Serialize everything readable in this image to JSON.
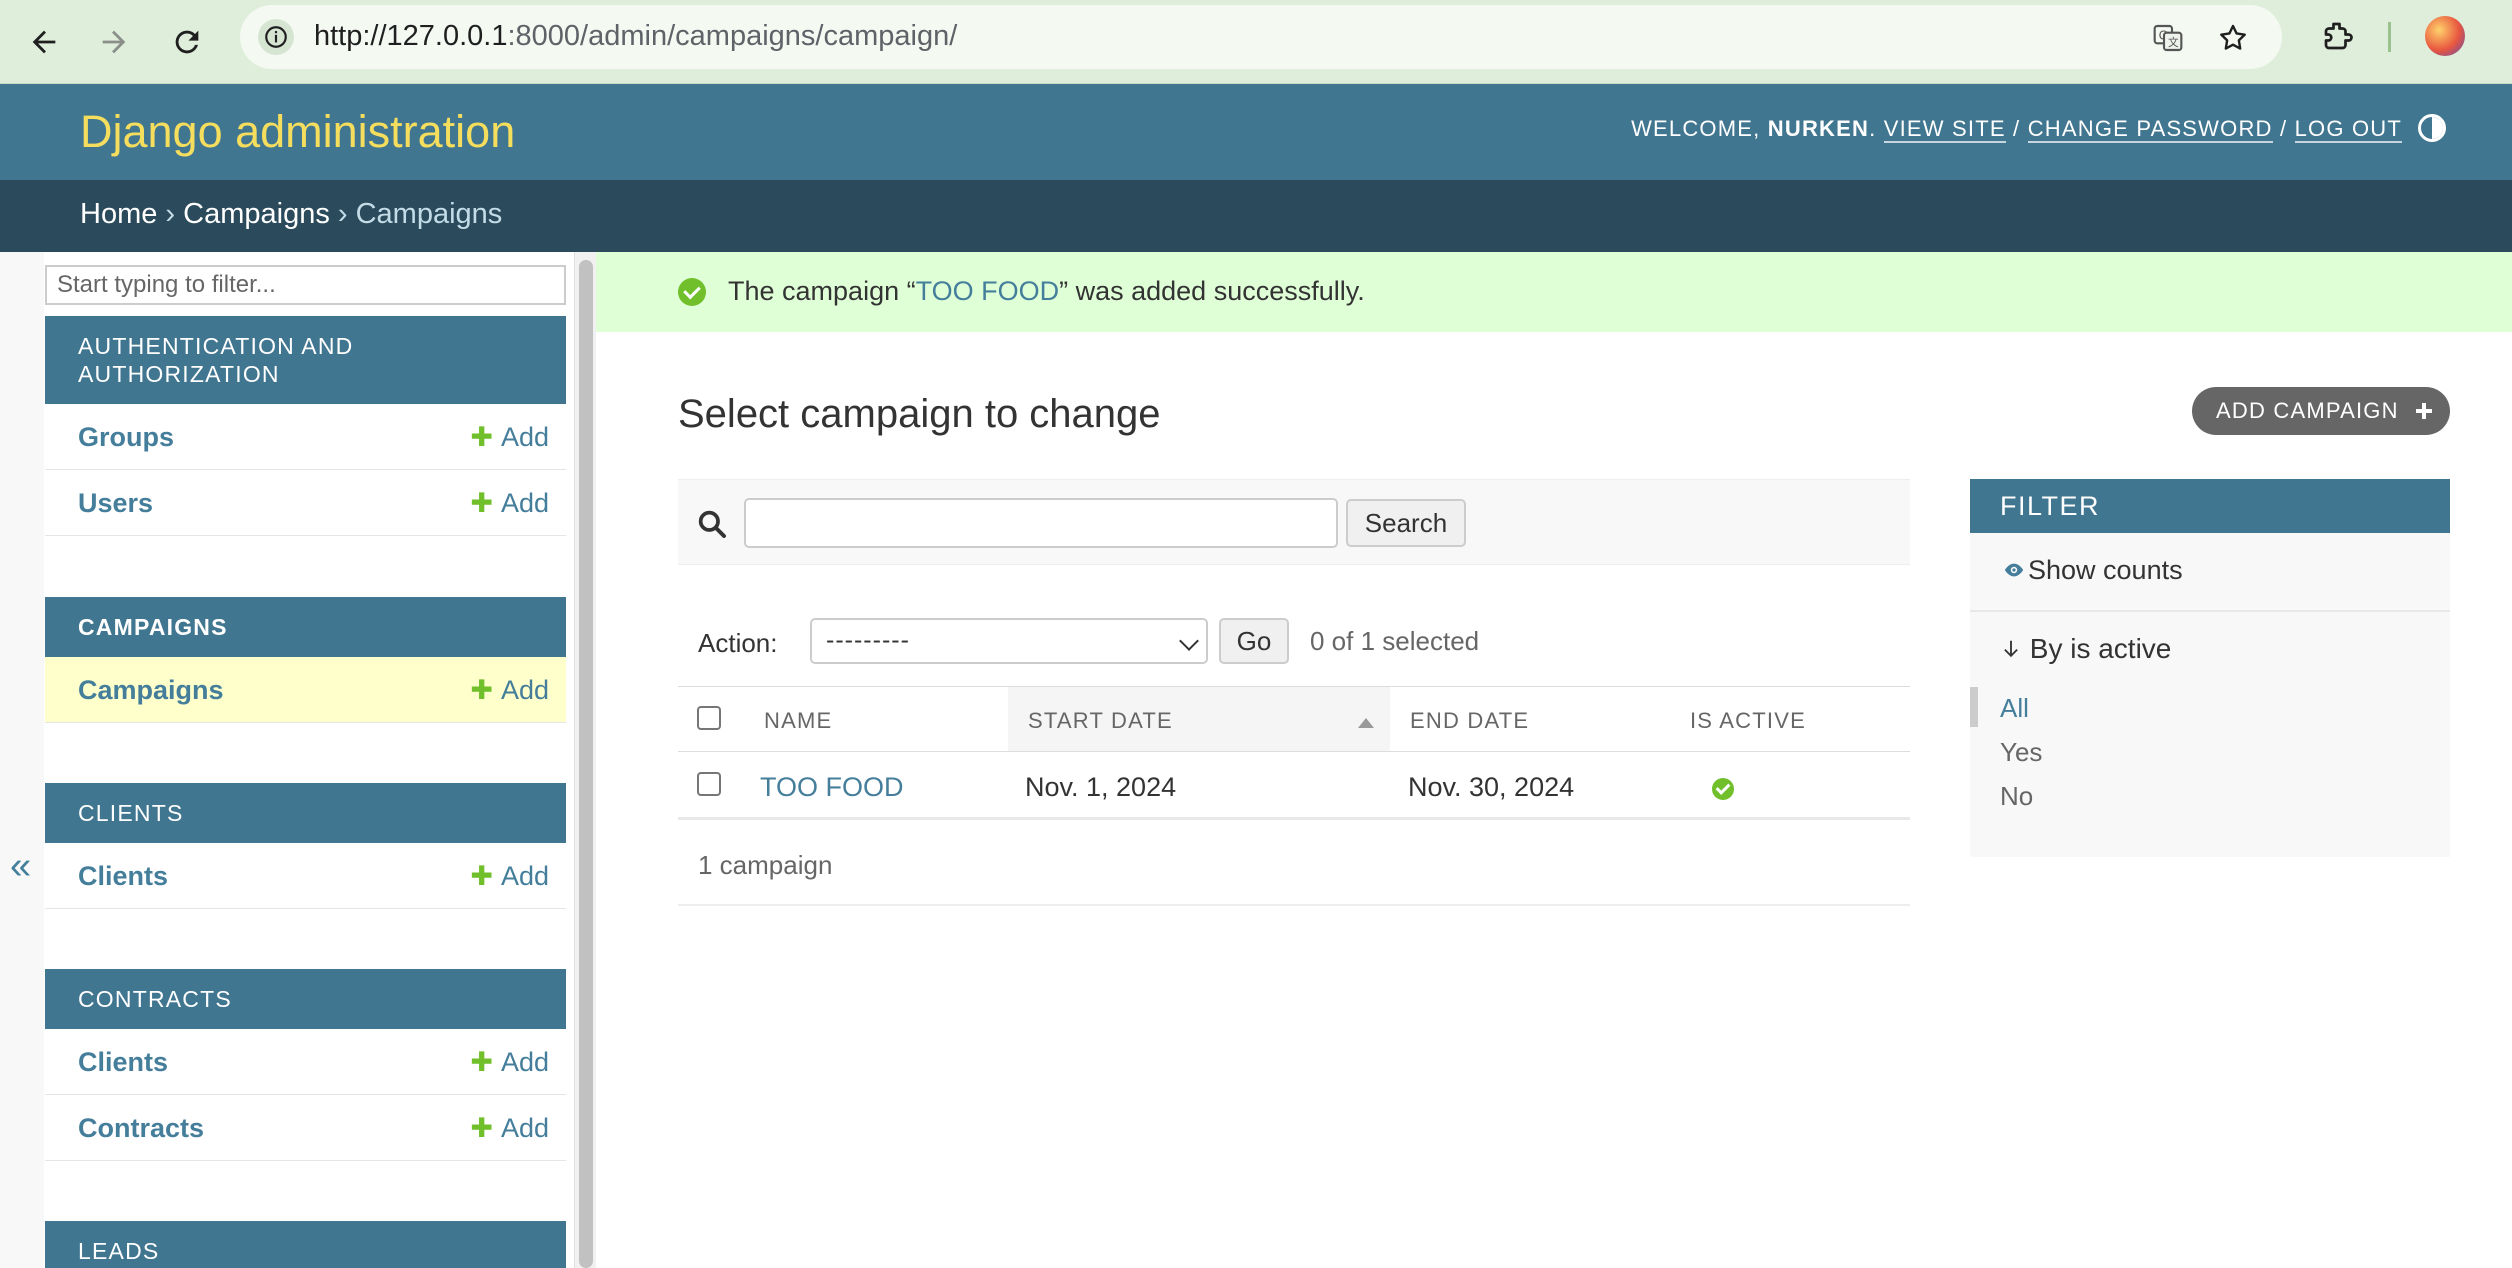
{
  "browser": {
    "url_host": "http://127.0.0.1",
    "url_rest": ":8000/admin/campaigns/campaign/"
  },
  "header": {
    "branding": "Django administration",
    "welcome": "Welcome,",
    "username": "Nurken",
    "view_site": "View site",
    "change_password": "Change password",
    "log_out": "Log out"
  },
  "breadcrumbs": {
    "home": "Home",
    "sep1": " › ",
    "app": "Campaigns",
    "sep2": " › ",
    "current": "Campaigns"
  },
  "sidebar": {
    "filter_placeholder": "Start typing to filter...",
    "collapse_glyph": "«",
    "add_label": "Add",
    "modules": {
      "auth": {
        "caption_line1": "Authentication and",
        "caption_line2": "authorization",
        "models": [
          "Groups",
          "Users"
        ]
      },
      "campaigns": {
        "caption": "Campaigns",
        "models": [
          "Campaigns"
        ]
      },
      "clients": {
        "caption": "Clients",
        "models": [
          "Clients"
        ]
      },
      "contracts": {
        "caption": "Contracts",
        "models": [
          "Clients",
          "Contracts"
        ]
      },
      "leads": {
        "caption": "Leads"
      }
    }
  },
  "messages": {
    "success_before": "The campaign “",
    "success_object": "TOO FOOD",
    "success_after": "” was added successfully."
  },
  "content": {
    "title": "Select campaign to change",
    "add_button": "Add campaign",
    "search_button": "Search",
    "search_value": "",
    "action_label": "Action:",
    "action_selected": "---------",
    "go_button": "Go",
    "selected_count": "0 of 1 selected",
    "columns": [
      "Name",
      "Start date",
      "End date",
      "Is active"
    ],
    "rows": [
      {
        "name": "TOO FOOD",
        "start_date": "Nov. 1, 2024",
        "end_date": "Nov. 30, 2024",
        "is_active": true
      }
    ],
    "paginator": "1 campaign"
  },
  "filter": {
    "title": "Filter",
    "show_counts": "Show counts",
    "heading": "By is active",
    "options": [
      "All",
      "Yes",
      "No"
    ],
    "selected": "All"
  },
  "colors": {
    "header_bg": "#417690",
    "breadcrumbs_bg": "#2b4b5c",
    "branding": "#f5dd5d",
    "link": "#447e9b",
    "add_green": "#70bf2b",
    "success_bg": "#dfffd7",
    "current_model_bg": "#ffffcc"
  },
  "icons": [
    "back-arrow-icon",
    "forward-arrow-icon",
    "reload-icon",
    "site-info-icon",
    "translate-icon",
    "bookmark-star-icon",
    "extensions-icon",
    "theme-toggle-icon",
    "success-check-icon",
    "search-icon",
    "plus-circle-icon",
    "eye-icon",
    "arrow-down-icon",
    "active-check-icon"
  ]
}
